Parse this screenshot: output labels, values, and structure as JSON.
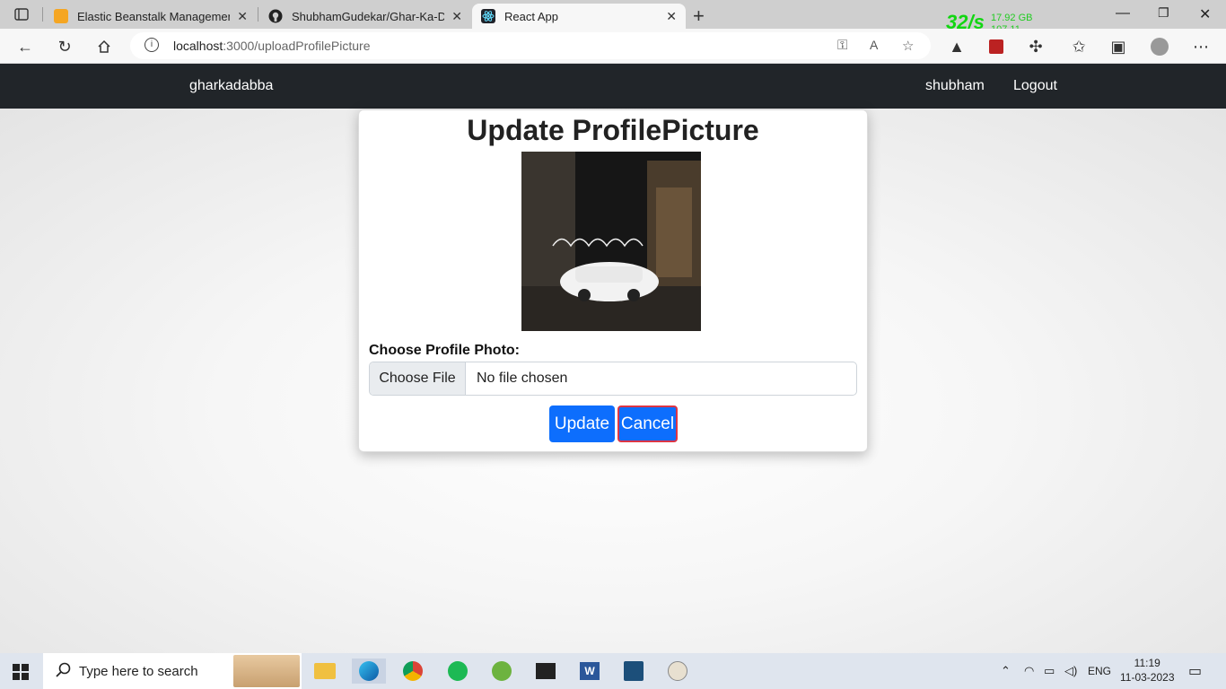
{
  "browser": {
    "tabs": [
      {
        "title": "Elastic Beanstalk Management Co",
        "icon": "aws-box-icon"
      },
      {
        "title": "ShubhamGudekar/Ghar-Ka-Dabb",
        "icon": "github-icon"
      },
      {
        "title": "React App",
        "icon": "react-icon"
      }
    ],
    "perf": {
      "rate": "32/s",
      "memory": "17.92 GB",
      "value": "107.11"
    },
    "url": {
      "host": "localhost",
      "rest": ":3000/uploadProfilePicture"
    }
  },
  "navbar": {
    "brand": "gharkadabba",
    "user": "shubham",
    "logout": "Logout"
  },
  "card": {
    "title": "Update ProfilePicture",
    "label": "Choose Profile Photo:",
    "choose_file": "Choose File",
    "no_file": "No file chosen",
    "update": "Update",
    "cancel": "Cancel"
  },
  "taskbar": {
    "search_placeholder": "Type here to search",
    "lang": "ENG",
    "time": "11:19",
    "date": "11-03-2023"
  },
  "colors": {
    "navbar": "#212529",
    "primary": "#0d6efd",
    "cancel_border": "#dc3545"
  }
}
